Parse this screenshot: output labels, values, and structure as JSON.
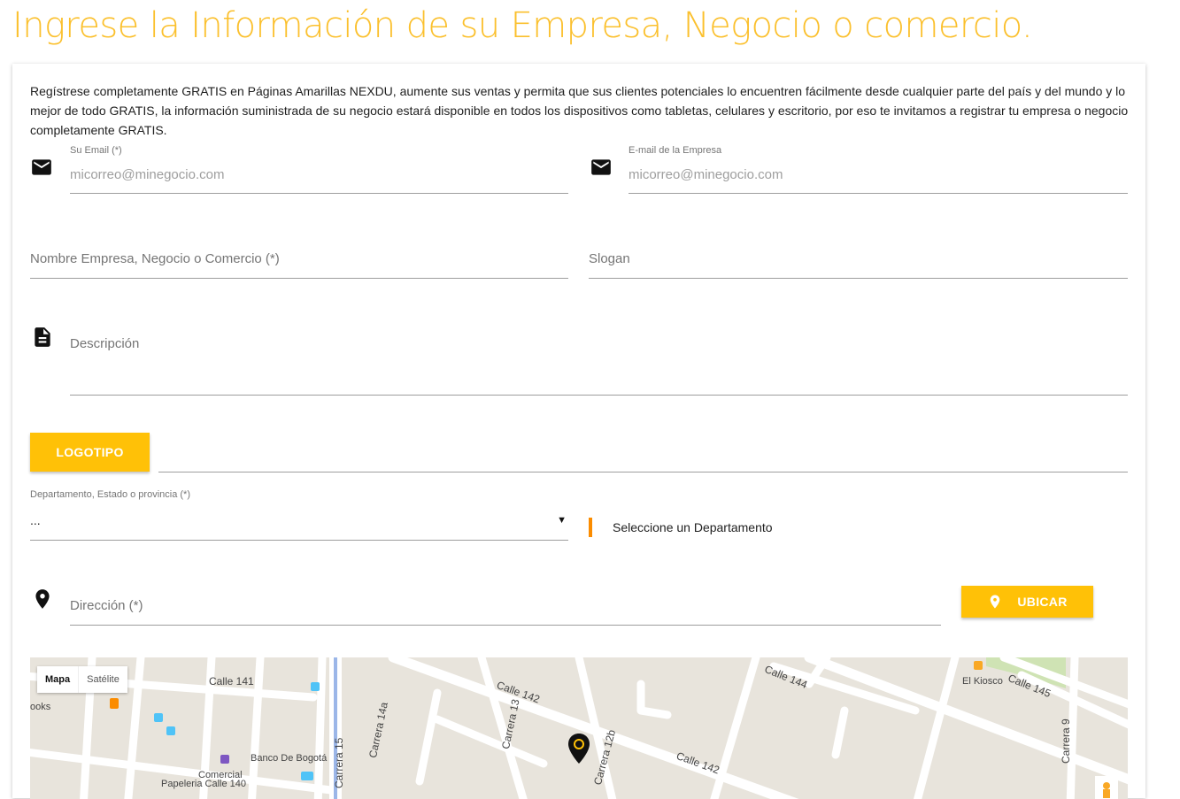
{
  "page": {
    "title": "Ingrese la Información de su Empresa, Negocio o comercio."
  },
  "intro": "Regístrese completamente GRATIS en Páginas Amarillas NEXDU, aumente sus ventas y permita que sus clientes potenciales lo encuentren fácilmente desde cualquier parte del país y del mundo y lo mejor de todo GRATIS, la información suministrada de su negocio estará disponible en todos los dispositivos como tabletas, celulares y escritorio, por eso te invitamos a registrar tu empresa o negocio completamente GRATIS.",
  "form": {
    "user_email": {
      "label": "Su Email (*)",
      "placeholder": "micorreo@minegocio.com",
      "icon": "email-icon"
    },
    "company_email": {
      "label": "E-mail de la Empresa",
      "placeholder": "micorreo@minegocio.com",
      "icon": "email-icon"
    },
    "company_name": {
      "placeholder": "Nombre Empresa, Negocio o Comercio (*)"
    },
    "slogan": {
      "placeholder": "Slogan"
    },
    "description": {
      "placeholder": "Descripción",
      "icon": "description-icon"
    },
    "logo_button": "LOGOTIPO",
    "department": {
      "label": "Departamento, Estado o provincia (*)",
      "selected": "..."
    },
    "city_hint": "Seleccione un Departamento",
    "address": {
      "placeholder": "Dirección (*)",
      "icon": "location-pin-icon"
    },
    "locate_button": "UBICAR"
  },
  "map": {
    "type_controls": {
      "map": "Mapa",
      "satellite": "Satélite"
    },
    "streets": {
      "calle_141": "Calle 141",
      "calle_142a": "Calle 142",
      "calle_142b": "Calle 142",
      "calle_144": "Calle 144",
      "calle_145": "Calle 145",
      "carrera_15": "Carrera 15",
      "carrera_14a": "Carrera 14a",
      "carrera_13": "Carrera 13",
      "carrera_12b": "Carrera 12b",
      "carrera_9": "Carrera 9"
    },
    "places": {
      "banco": "Banco De Bogotá",
      "kiosco": "El Kiosco",
      "books": "ooks",
      "comercial": "Comercial",
      "papeleria": "Papeleria Calle 140"
    }
  },
  "colors": {
    "brand_yellow": "#ffc107",
    "title_yellow": "#fbc02d",
    "accent_orange": "#fb8c00"
  }
}
